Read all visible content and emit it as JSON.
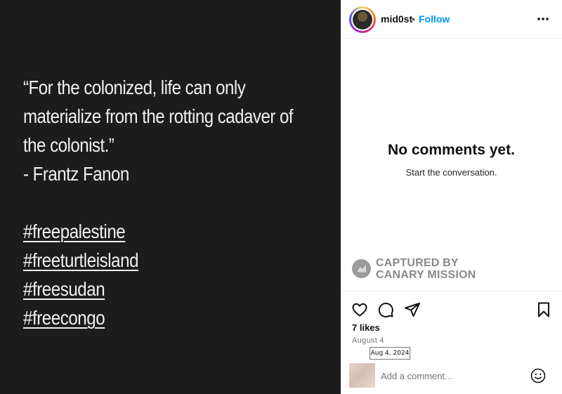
{
  "post": {
    "quote_lines": [
      "“For the colonized, life can only",
      "materialize from the rotting cadaver of",
      "the colonist.”",
      "- Frantz Fanon"
    ],
    "hashtags": [
      "#freepalestine",
      "#freeturtleisland",
      "#freesudan",
      "#freecongo"
    ],
    "background_color": "#1c1c1c"
  },
  "header": {
    "username": "mid0st",
    "separator": "•",
    "follow_label": "Follow",
    "more_icon": "more-horizontal-icon",
    "accent_color": "#0095f6"
  },
  "comments": {
    "empty_title": "No comments yet.",
    "empty_subtitle": "Start the conversation."
  },
  "watermark": {
    "line1": "CAPTURED BY",
    "line2": "CANARY MISSION"
  },
  "actions": {
    "icons": [
      "heart-icon",
      "comment-icon",
      "share-icon",
      "bookmark-icon"
    ],
    "likes": "7 likes",
    "date": "August 4",
    "date_tooltip": "Aug 4, 2024"
  },
  "comment_box": {
    "placeholder": "Add a comment...",
    "emoji_icon": "emoji-icon"
  }
}
